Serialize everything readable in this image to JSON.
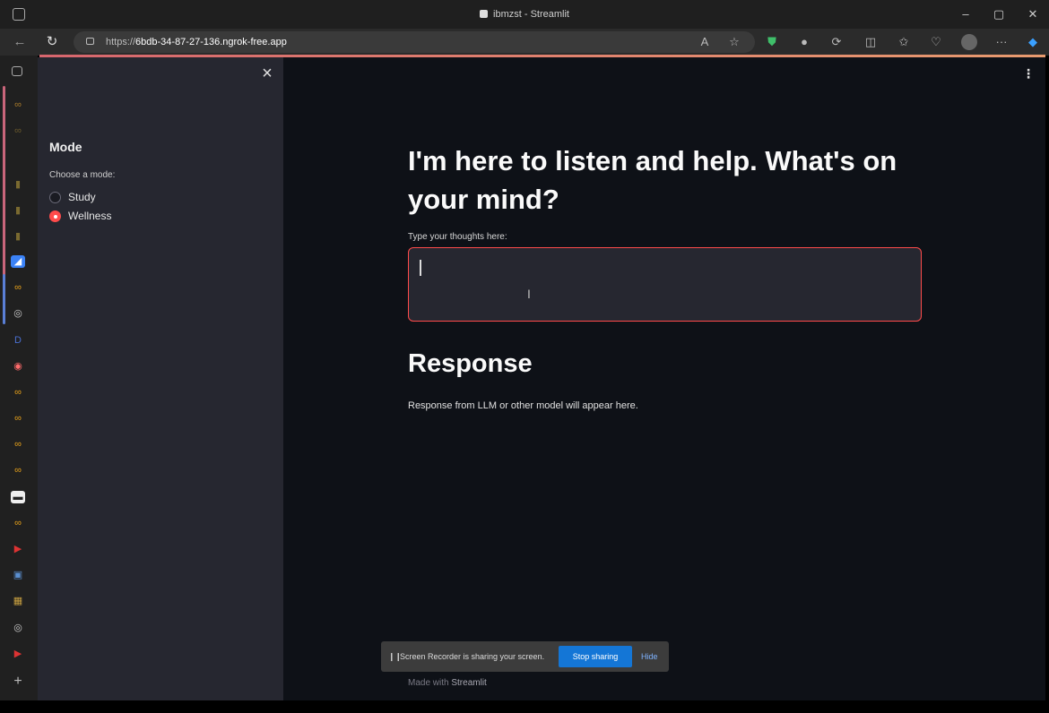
{
  "window": {
    "title": "ibmzst - Streamlit",
    "minimize": "–",
    "maximize": "▢",
    "close": "✕"
  },
  "browser": {
    "back": "←",
    "reload": "↻",
    "url_prefix": "https://",
    "url_host": "6bdb-34-87-27-136.ngrok-free.app",
    "more": "···"
  },
  "sidebar": {
    "close": "×",
    "title": "Mode",
    "label": "Choose a mode:",
    "options": [
      {
        "label": "Study",
        "selected": false
      },
      {
        "label": "Wellness",
        "selected": true
      }
    ]
  },
  "main": {
    "menu": "⋮",
    "heading": "I'm here to listen and help. What's on your mind?",
    "input_label": "Type your thoughts here:",
    "input_value": "",
    "response_heading": "Response",
    "response_text": "Response from LLM or other model will appear here.",
    "footer_prefix": "Made with ",
    "footer_brand": "Streamlit"
  },
  "share_bar": {
    "message": "Screen Recorder is sharing your screen.",
    "stop_label": "Stop sharing",
    "hide_label": "Hide"
  },
  "colors": {
    "accent": "#ff4b4b",
    "sidebar_bg": "#262730",
    "main_bg": "#0e1117",
    "stop_button": "#1476d6"
  }
}
